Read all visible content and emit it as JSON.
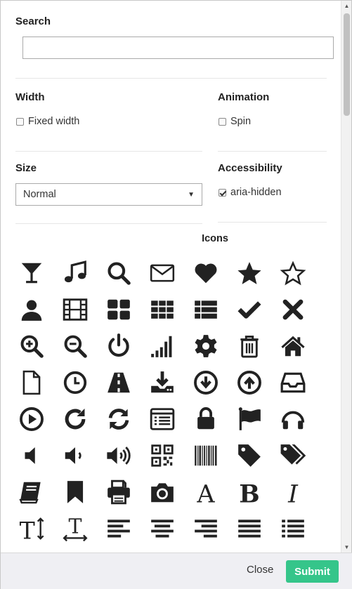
{
  "search": {
    "label": "Search",
    "value": "",
    "placeholder": ""
  },
  "width": {
    "label": "Width",
    "option_label": "Fixed width",
    "checked": false
  },
  "animation": {
    "label": "Animation",
    "option_label": "Spin",
    "checked": false
  },
  "size": {
    "label": "Size",
    "selected": "Normal"
  },
  "accessibility": {
    "label": "Accessibility",
    "option_label": "aria-hidden",
    "checked": true
  },
  "icons": {
    "title": "Icons",
    "items": [
      "glass-icon",
      "music-icon",
      "search-icon",
      "envelope-icon",
      "heart-icon",
      "star-icon",
      "star-outline-icon",
      "user-icon",
      "film-icon",
      "th-large-icon",
      "th-icon",
      "th-list-icon",
      "check-icon",
      "times-icon",
      "zoom-in-icon",
      "zoom-out-icon",
      "power-icon",
      "signal-icon",
      "cog-icon",
      "trash-icon",
      "home-icon",
      "file-icon",
      "clock-icon",
      "road-icon",
      "download-icon",
      "arrow-circle-down-icon",
      "arrow-circle-up-icon",
      "inbox-icon",
      "play-circle-icon",
      "repeat-icon",
      "refresh-icon",
      "list-alt-icon",
      "lock-icon",
      "flag-icon",
      "headphones-icon",
      "volume-off-icon",
      "volume-down-icon",
      "volume-up-icon",
      "qrcode-icon",
      "barcode-icon",
      "tag-icon",
      "tags-icon",
      "book-icon",
      "bookmark-icon",
      "print-icon",
      "camera-icon",
      "font-icon",
      "bold-icon",
      "italic-icon",
      "text-height-icon",
      "text-width-icon",
      "align-left-icon",
      "align-center-icon",
      "align-right-icon",
      "align-justify-icon",
      "list-icon"
    ]
  },
  "footer": {
    "close_label": "Close",
    "submit_label": "Submit"
  }
}
